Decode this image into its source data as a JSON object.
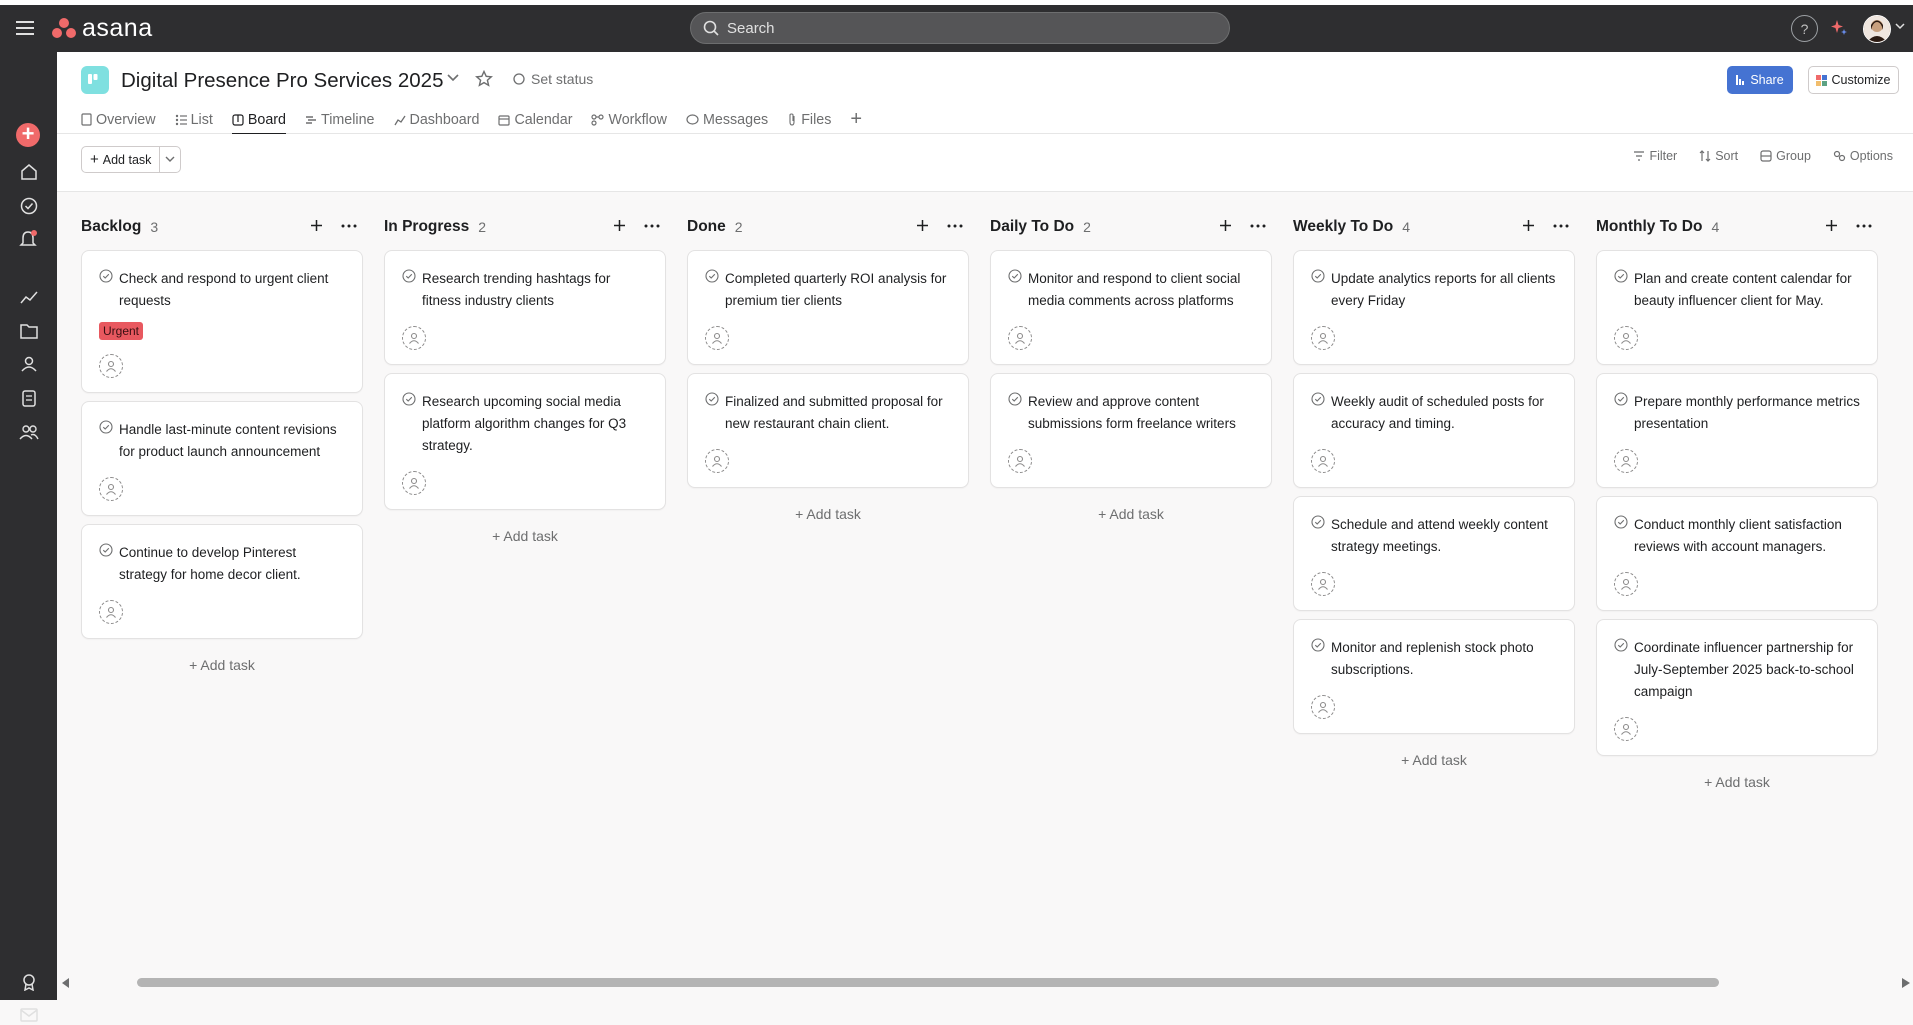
{
  "topbar": {
    "logo_text": "asana",
    "search_placeholder": "Search",
    "help_label": "?"
  },
  "sidebar": {
    "icons": [
      "create-icon",
      "home-icon",
      "my-tasks-icon",
      "inbox-icon",
      "reporting-icon",
      "projects-icon",
      "portfolios-icon",
      "goals-icon",
      "teams-icon",
      "achievements-icon",
      "mail-icon"
    ]
  },
  "project": {
    "title": "Digital Presence Pro Services 2025",
    "set_status": "Set status",
    "share": "Share",
    "customize": "Customize",
    "more_people": "···",
    "tabs": [
      {
        "label": "Overview",
        "icon": "overview-icon",
        "active": false
      },
      {
        "label": "List",
        "icon": "list-icon",
        "active": false
      },
      {
        "label": "Board",
        "icon": "board-icon",
        "active": true
      },
      {
        "label": "Timeline",
        "icon": "timeline-icon",
        "active": false
      },
      {
        "label": "Dashboard",
        "icon": "dashboard-icon",
        "active": false
      },
      {
        "label": "Calendar",
        "icon": "calendar-icon",
        "active": false
      },
      {
        "label": "Workflow",
        "icon": "workflow-icon",
        "active": false
      },
      {
        "label": "Messages",
        "icon": "messages-icon",
        "active": false
      },
      {
        "label": "Files",
        "icon": "files-icon",
        "active": false
      }
    ]
  },
  "toolbar": {
    "add_task": "Add task",
    "filter": "Filter",
    "sort": "Sort",
    "group": "Group",
    "options": "Options"
  },
  "columns": [
    {
      "title": "Backlog",
      "count": "3",
      "add_label": "+ Add task",
      "cards": [
        {
          "text": "Check and respond to urgent client requests",
          "tag": "Urgent"
        },
        {
          "text": "Handle last-minute content revisions for product launch announcement",
          "tag": ""
        },
        {
          "text": "Continue to develop Pinterest strategy for home decor client.",
          "tag": ""
        }
      ]
    },
    {
      "title": "In Progress",
      "count": "2",
      "add_label": "+ Add task",
      "cards": [
        {
          "text": "Research trending hashtags for fitness industry clients",
          "tag": ""
        },
        {
          "text": "Research upcoming social media platform algorithm changes for Q3 strategy.",
          "tag": ""
        }
      ]
    },
    {
      "title": "Done",
      "count": "2",
      "add_label": "+ Add task",
      "cards": [
        {
          "text": "Completed quarterly ROI analysis for premium tier clients",
          "tag": ""
        },
        {
          "text": "Finalized and submitted proposal for new restaurant chain client.",
          "tag": ""
        }
      ]
    },
    {
      "title": "Daily To Do",
      "count": "2",
      "add_label": "+ Add task",
      "cards": [
        {
          "text": "Monitor and respond to client social media comments across platforms",
          "tag": ""
        },
        {
          "text": "Review and approve content submissions form freelance writers",
          "tag": ""
        }
      ]
    },
    {
      "title": "Weekly To Do",
      "count": "4",
      "add_label": "+ Add task",
      "cards": [
        {
          "text": "Update analytics reports for all clients every Friday",
          "tag": ""
        },
        {
          "text": "Weekly audit of scheduled posts for accuracy and timing.",
          "tag": ""
        },
        {
          "text": "Schedule and attend weekly content strategy meetings.",
          "tag": ""
        },
        {
          "text": "Monitor and replenish stock photo subscriptions.",
          "tag": ""
        }
      ]
    },
    {
      "title": "Monthly To Do",
      "count": "4",
      "add_label": "+ Add task",
      "cards": [
        {
          "text": "Plan and create content calendar for beauty influencer client for May.",
          "tag": ""
        },
        {
          "text": "Prepare monthly performance metrics presentation",
          "tag": ""
        },
        {
          "text": "Conduct monthly client satisfaction reviews with account managers.",
          "tag": ""
        },
        {
          "text": "Coordinate influencer partnership for July-September 2025 back-to-school campaign",
          "tag": ""
        }
      ]
    }
  ],
  "colors": {
    "topbar": "#2e2e30",
    "brand": "#f06a6a",
    "share": "#4573d2",
    "urgent_tag": "#e8585f"
  }
}
